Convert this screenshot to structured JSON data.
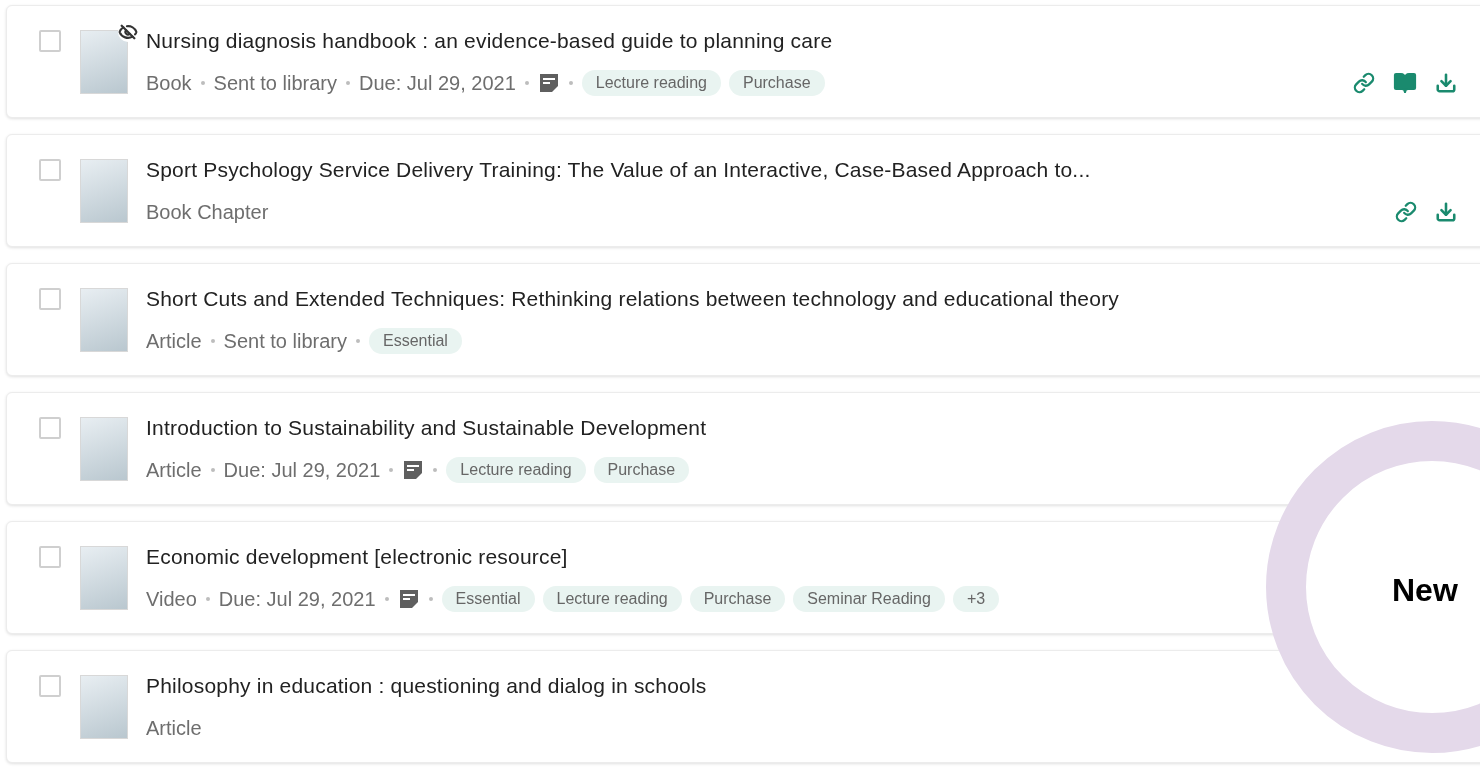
{
  "items": [
    {
      "title": "Nursing diagnosis handbook : an evidence-based guide to planning care",
      "checked": false,
      "hidden": true,
      "meta": [
        {
          "kind": "text",
          "text": "Book"
        },
        {
          "kind": "text",
          "text": "Sent to library"
        },
        {
          "kind": "text",
          "text": "Due: Jul 29, 2021"
        },
        {
          "kind": "note"
        },
        {
          "kind": "tag",
          "text": "Lecture reading"
        },
        {
          "kind": "tag",
          "text": "Purchase"
        }
      ],
      "link": true,
      "read": true,
      "download": true
    },
    {
      "title": "Sport Psychology Service Delivery Training: The Value of an Interactive, Case-Based Approach to...",
      "checked": false,
      "hidden": false,
      "meta": [
        {
          "kind": "text",
          "text": "Book Chapter"
        }
      ],
      "link": true,
      "read": false,
      "download": true
    },
    {
      "title": "Short Cuts and Extended Techniques: Rethinking relations between technology and educational theory",
      "checked": false,
      "hidden": false,
      "meta": [
        {
          "kind": "text",
          "text": "Article"
        },
        {
          "kind": "text",
          "text": "Sent to library"
        },
        {
          "kind": "tag",
          "text": "Essential"
        }
      ]
    },
    {
      "title": "Introduction to Sustainability and Sustainable Development",
      "checked": false,
      "hidden": false,
      "meta": [
        {
          "kind": "text",
          "text": "Article"
        },
        {
          "kind": "text",
          "text": "Due: Jul 29, 2021"
        },
        {
          "kind": "note"
        },
        {
          "kind": "tag",
          "text": "Lecture reading"
        },
        {
          "kind": "tag",
          "text": "Purchase"
        }
      ]
    },
    {
      "title": "Economic development [electronic resource]",
      "checked": false,
      "hidden": false,
      "meta": [
        {
          "kind": "text",
          "text": "Video"
        },
        {
          "kind": "text",
          "text": "Due: Jul 29, 2021"
        },
        {
          "kind": "note"
        },
        {
          "kind": "tag",
          "text": "Essential"
        },
        {
          "kind": "tag",
          "text": "Lecture reading"
        },
        {
          "kind": "tag",
          "text": "Purchase"
        },
        {
          "kind": "tag",
          "text": "Seminar Reading"
        },
        {
          "kind": "tag",
          "text": "+3"
        }
      ]
    },
    {
      "title": "Philosophy in education : questioning and dialog in schools",
      "checked": false,
      "hidden": false,
      "meta": [
        {
          "kind": "text",
          "text": "Article"
        }
      ]
    }
  ],
  "overlay": {
    "label": "New"
  }
}
